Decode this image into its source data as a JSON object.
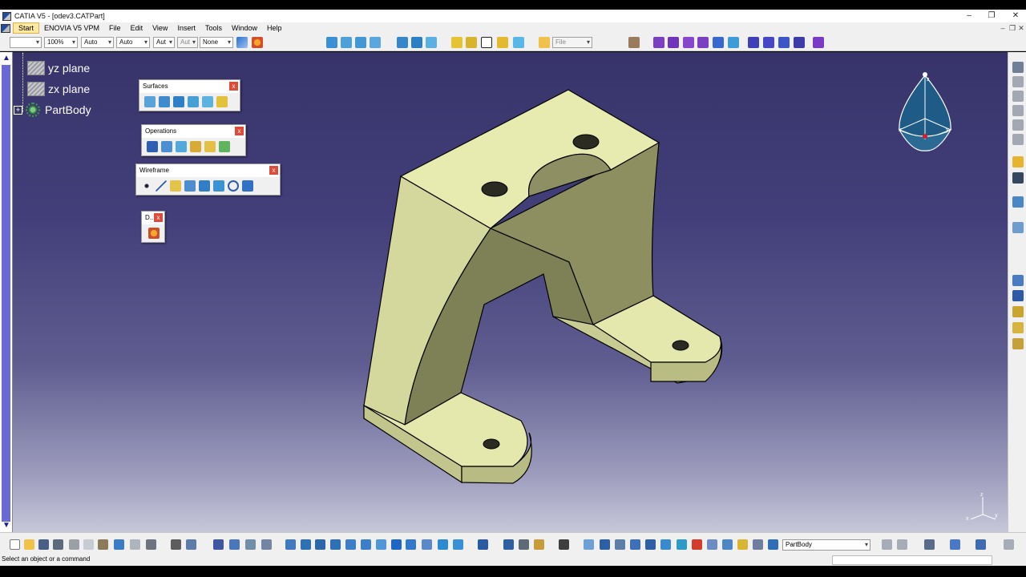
{
  "window": {
    "title": "CATIA V5 - [odev3.CATPart]",
    "minimize_glyph": "–",
    "restore_glyph": "❐",
    "close_glyph": "✕"
  },
  "menu": {
    "items": [
      "Start",
      "ENOVIA V5 VPM",
      "File",
      "Edit",
      "View",
      "Insert",
      "Tools",
      "Window",
      "Help"
    ],
    "active_item": "Start",
    "mdi_minimize_glyph": "–",
    "mdi_restore_glyph": "❐",
    "mdi_close_glyph": "✕"
  },
  "toolbar_top": {
    "line_combo": "",
    "zoom_combo": "100%",
    "combo_a": "Auto",
    "combo_b": "Auto",
    "combo_c": "Aut",
    "combo_d": "Aut",
    "layer_combo": "None",
    "file_label": "File"
  },
  "tree": {
    "items": [
      {
        "label": "yz plane",
        "icon": "plane-icon"
      },
      {
        "label": "zx plane",
        "icon": "plane-icon"
      },
      {
        "label": "PartBody",
        "icon": "partbody-icon"
      }
    ],
    "expander_glyph": "+"
  },
  "palettes": {
    "surfaces": {
      "title": "Surfaces",
      "close": "x"
    },
    "operations": {
      "title": "Operations",
      "close": "x"
    },
    "wireframe": {
      "title": "Wireframe",
      "close": "x"
    },
    "d": {
      "title": "D..",
      "close": "x"
    }
  },
  "compass": {
    "x_label": "x",
    "y_label": "y",
    "z_label": "z"
  },
  "triad": {
    "x_label": "x",
    "y_label": "y",
    "z_label": "z"
  },
  "toolbar_bottom": {
    "current_body": "PartBody"
  },
  "status": {
    "prompt": "Select an object or a command"
  },
  "colors": {
    "viewport_top": "#37336a",
    "viewport_bottom": "#c7c7da",
    "part_fill_top": "#e8ebaf",
    "part_fill_side": "#b8bb83",
    "part_fill_shadow": "#7d7f56",
    "scrollbar": "#6a6ad6"
  }
}
